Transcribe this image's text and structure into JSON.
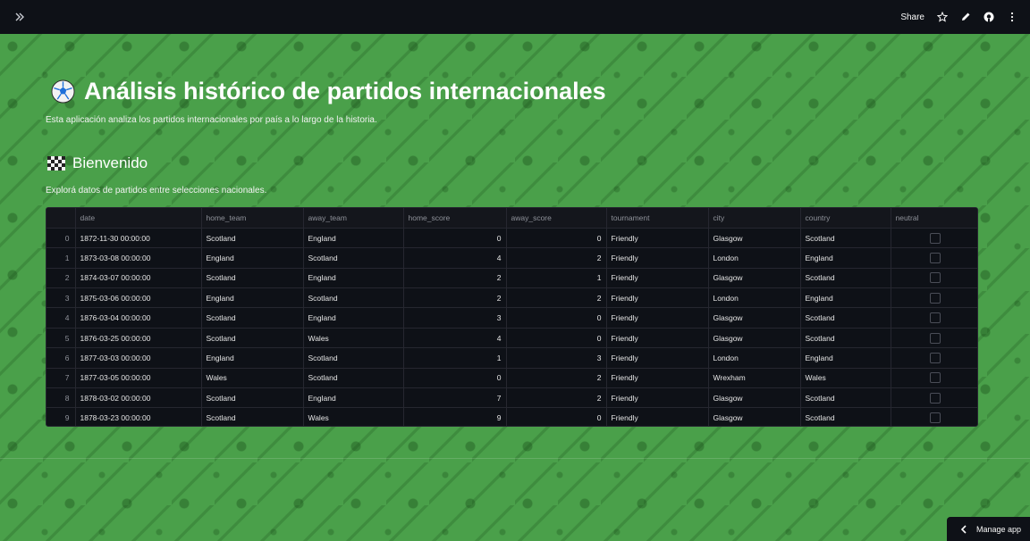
{
  "header": {
    "share_label": "Share"
  },
  "main": {
    "title": "Análisis histórico de partidos internacionales",
    "intro": "Esta aplicación analiza los partidos internacionales por país a lo largo de la historia.",
    "subheader": "Bienvenido",
    "welcome_text": "Explorá datos de partidos entre selecciones nacionales."
  },
  "table": {
    "columns": [
      "",
      "date",
      "home_team",
      "away_team",
      "home_score",
      "away_score",
      "tournament",
      "city",
      "country",
      "neutral"
    ],
    "rows": [
      [
        "0",
        "1872-11-30 00:00:00",
        "Scotland",
        "England",
        "0",
        "0",
        "Friendly",
        "Glasgow",
        "Scotland"
      ],
      [
        "1",
        "1873-03-08 00:00:00",
        "England",
        "Scotland",
        "4",
        "2",
        "Friendly",
        "London",
        "England"
      ],
      [
        "2",
        "1874-03-07 00:00:00",
        "Scotland",
        "England",
        "2",
        "1",
        "Friendly",
        "Glasgow",
        "Scotland"
      ],
      [
        "3",
        "1875-03-06 00:00:00",
        "England",
        "Scotland",
        "2",
        "2",
        "Friendly",
        "London",
        "England"
      ],
      [
        "4",
        "1876-03-04 00:00:00",
        "Scotland",
        "England",
        "3",
        "0",
        "Friendly",
        "Glasgow",
        "Scotland"
      ],
      [
        "5",
        "1876-03-25 00:00:00",
        "Scotland",
        "Wales",
        "4",
        "0",
        "Friendly",
        "Glasgow",
        "Scotland"
      ],
      [
        "6",
        "1877-03-03 00:00:00",
        "England",
        "Scotland",
        "1",
        "3",
        "Friendly",
        "London",
        "England"
      ],
      [
        "7",
        "1877-03-05 00:00:00",
        "Wales",
        "Scotland",
        "0",
        "2",
        "Friendly",
        "Wrexham",
        "Wales"
      ],
      [
        "8",
        "1878-03-02 00:00:00",
        "Scotland",
        "England",
        "7",
        "2",
        "Friendly",
        "Glasgow",
        "Scotland"
      ],
      [
        "9",
        "1878-03-23 00:00:00",
        "Scotland",
        "Wales",
        "9",
        "0",
        "Friendly",
        "Glasgow",
        "Scotland"
      ]
    ]
  },
  "footer": {
    "manage_app_label": "Manage app"
  },
  "colors": {
    "background": "#4aa04a",
    "topbar": "#0e1117",
    "table_bg": "#0e1117"
  }
}
